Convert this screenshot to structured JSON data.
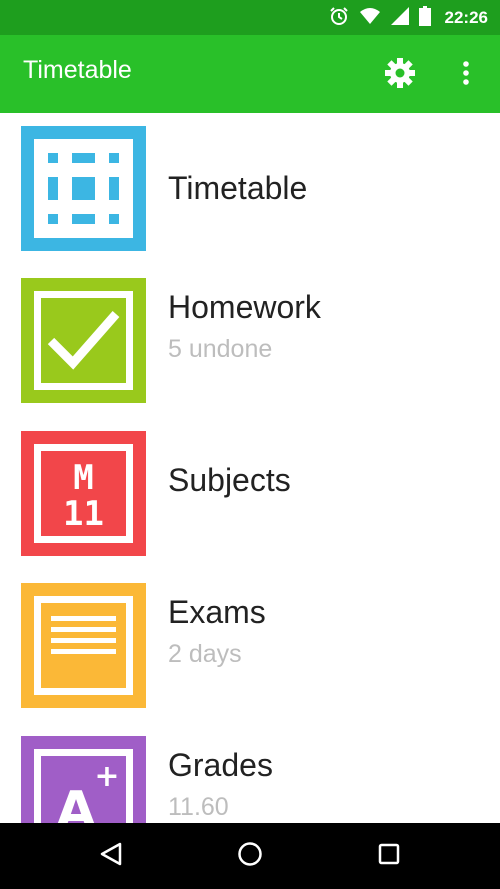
{
  "status_bar": {
    "time": "22:26",
    "icons": [
      "alarm-icon",
      "wifi-icon",
      "signal-icon",
      "battery-icon"
    ]
  },
  "app_bar": {
    "title": "Timetable",
    "actions": [
      "settings-icon",
      "more-vert-icon"
    ]
  },
  "menu": {
    "items": [
      {
        "title": "Timetable",
        "subtitle": "",
        "color": "#3cb6e3",
        "icon": "timetable-grid-icon"
      },
      {
        "title": "Homework",
        "subtitle": "5 undone",
        "color": "#99c91c",
        "icon": "homework-check-icon"
      },
      {
        "title": "Subjects",
        "subtitle": "",
        "color": "#f2464a",
        "icon": "subjects-icon",
        "icon_text": [
          "M",
          "11"
        ]
      },
      {
        "title": "Exams",
        "subtitle": "2 days",
        "color": "#fbb837",
        "icon": "exams-icon"
      },
      {
        "title": "Grades",
        "subtitle": "11.60",
        "color": "#a05ec7",
        "icon": "grades-icon",
        "icon_text": [
          "A",
          "+"
        ]
      }
    ]
  },
  "nav_bar": {
    "buttons": [
      "back-icon",
      "home-icon",
      "recents-icon"
    ]
  },
  "colors": {
    "status_bar": "#1e9e1e",
    "app_bar": "#29c029",
    "subtitle": "#bdbdbd"
  }
}
